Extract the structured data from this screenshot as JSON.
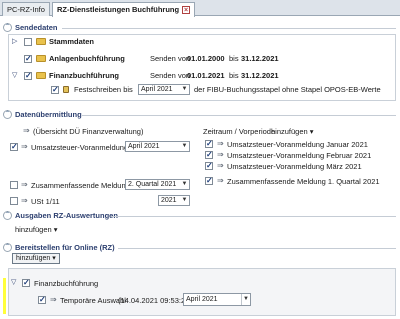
{
  "tabs": [
    {
      "label": "PC-RZ-Info"
    },
    {
      "label": "RZ-Dienstleistungen Buchführung",
      "close": "×"
    }
  ],
  "sections": {
    "sendedaten": {
      "title": "Sendedaten",
      "stammdaten": {
        "label": "Stammdaten"
      },
      "anlagen": {
        "label": "Anlagenbuchführung",
        "send_from_label": "Senden von",
        "from": "01.01.2000",
        "to_label": "bis",
        "to": "31.12.2021"
      },
      "finanz": {
        "label": "Finanzbuchführung",
        "send_from_label": "Senden von",
        "from": "01.01.2021",
        "to_label": "bis",
        "to": "31.12.2021",
        "festschreiben_label": "Festschreiben bis",
        "festschreiben_value": "April 2021",
        "festschreiben_note": "der FIBU-Buchungsstapel ohne Stapel OPOS-EB-Werte"
      }
    },
    "datenuebermittlung": {
      "title": "Datenübermittlung",
      "uebersicht": "(Übersicht DÜ Finanzverwaltung)",
      "zeitraum_label": "Zeitraum / Vorperiode",
      "hinzufuegen": "hinzufügen",
      "ustva": {
        "label": "Umsatzsteuer-Voranmeldung",
        "value": "April 2021"
      },
      "zm": {
        "label": "Zusammenfassende Meldung",
        "value": "2. Quartal 2021"
      },
      "ust": {
        "label": "USt 1/11",
        "value": "2021"
      },
      "vorperioden": [
        "Umsatzsteuer-Voranmeldung Januar 2021",
        "Umsatzsteuer-Voranmeldung Februar 2021",
        "Umsatzsteuer-Voranmeldung März 2021",
        "Zusammenfassende Meldung 1. Quartal 2021"
      ]
    },
    "ausgaben": {
      "title": "Ausgaben RZ-Auswertungen",
      "hinzufuegen": "hinzufügen"
    },
    "bereitstellen": {
      "title": "Bereitstellen für Online (RZ)",
      "hinzufuegen": "hinzufügen",
      "finanz_label": "Finanzbuchführung",
      "temp_label": "Temporäre Auswahl",
      "temp_time": "(14.04.2021 09:53:23)",
      "temp_value": "April 2021"
    }
  },
  "colors": {
    "highlight": "#ffff3a",
    "section_title": "#2c3f6f"
  }
}
